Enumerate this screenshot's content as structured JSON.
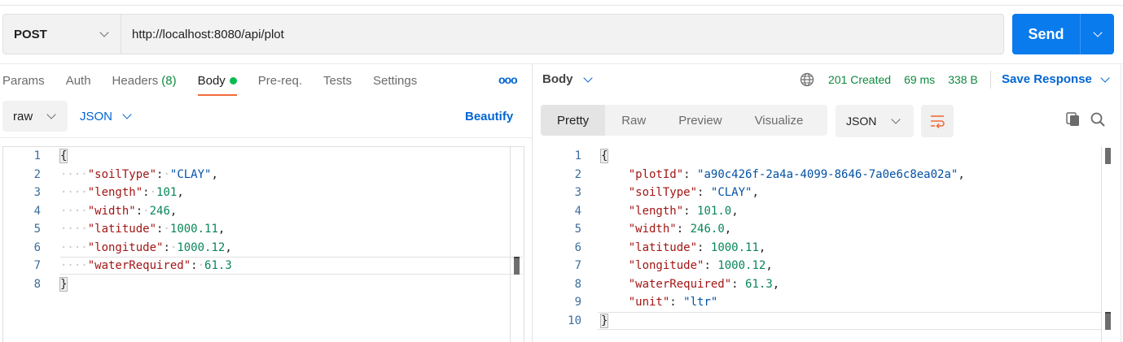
{
  "request": {
    "method": "POST",
    "url": "http://localhost:8080/api/plot",
    "send_label": "Send"
  },
  "request_tabs": [
    {
      "label": "Params"
    },
    {
      "label": "Auth"
    },
    {
      "label": "Headers",
      "count": "(8)"
    },
    {
      "label": "Body",
      "active": true
    },
    {
      "label": "Pre-req."
    },
    {
      "label": "Tests"
    },
    {
      "label": "Settings"
    }
  ],
  "more_label": "ooo",
  "body_options": {
    "mode": "raw",
    "language": "JSON",
    "beautify_label": "Beautify"
  },
  "request_body_lines": [
    {
      "n": "1",
      "text": "{"
    },
    {
      "n": "2",
      "key": "\"soilType\"",
      "value": "\"CLAY\"",
      "vtype": "str",
      "comma": ","
    },
    {
      "n": "3",
      "key": "\"length\"",
      "value": "101",
      "vtype": "num",
      "comma": ","
    },
    {
      "n": "4",
      "key": "\"width\"",
      "value": "246",
      "vtype": "num",
      "comma": ","
    },
    {
      "n": "5",
      "key": "\"latitude\"",
      "value": "1000.11",
      "vtype": "num",
      "comma": ","
    },
    {
      "n": "6",
      "key": "\"longitude\"",
      "value": "1000.12",
      "vtype": "num",
      "comma": ","
    },
    {
      "n": "7",
      "key": "\"waterRequired\"",
      "value": "61.3",
      "vtype": "num",
      "comma": ""
    },
    {
      "n": "8",
      "text": "}"
    }
  ],
  "response": {
    "body_label": "Body",
    "status": "201 Created",
    "time": "69 ms",
    "size": "338 B",
    "save_label": "Save Response",
    "view_tabs": [
      "Pretty",
      "Raw",
      "Preview",
      "Visualize"
    ],
    "language": "JSON"
  },
  "response_body_lines": [
    {
      "n": "1",
      "text": "{"
    },
    {
      "n": "2",
      "key": "\"plotId\"",
      "value": "\"a90c426f-2a4a-4099-8646-7a0e6c8ea02a\"",
      "vtype": "str",
      "comma": ","
    },
    {
      "n": "3",
      "key": "\"soilType\"",
      "value": "\"CLAY\"",
      "vtype": "str",
      "comma": ","
    },
    {
      "n": "4",
      "key": "\"length\"",
      "value": "101.0",
      "vtype": "num",
      "comma": ","
    },
    {
      "n": "5",
      "key": "\"width\"",
      "value": "246.0",
      "vtype": "num",
      "comma": ","
    },
    {
      "n": "6",
      "key": "\"latitude\"",
      "value": "1000.11",
      "vtype": "num",
      "comma": ","
    },
    {
      "n": "7",
      "key": "\"longitude\"",
      "value": "1000.12",
      "vtype": "num",
      "comma": ","
    },
    {
      "n": "8",
      "key": "\"waterRequired\"",
      "value": "61.3",
      "vtype": "num",
      "comma": ","
    },
    {
      "n": "9",
      "key": "\"unit\"",
      "value": "\"ltr\"",
      "vtype": "str",
      "comma": ""
    },
    {
      "n": "10",
      "text": "}"
    }
  ],
  "colors": {
    "send_blue": "#097bed",
    "link_blue": "#0265d2",
    "status_green": "#0c8a3e",
    "active_tab_underline": "#f26b3a",
    "body_dot": "#0cbb52"
  }
}
